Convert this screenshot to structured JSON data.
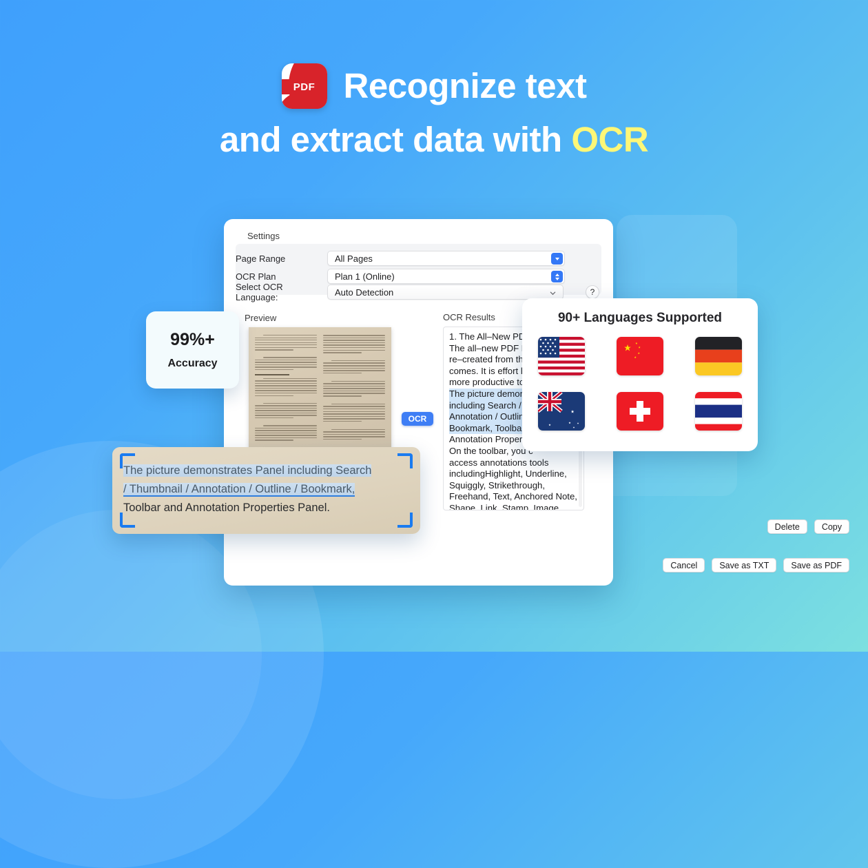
{
  "hero": {
    "icon_name": "pdf-app-icon",
    "icon_label": "PDF",
    "line1": "Recognize text",
    "line2_prefix": "and extract data with ",
    "line2_accent": "OCR",
    "accent_color": "#fdf777",
    "text_color": "#ffffff"
  },
  "background": {
    "gradient_start": "#3fa0fc",
    "gradient_end": "#7ce0e0"
  },
  "dialog": {
    "settings_title": "Settings",
    "rows": [
      {
        "label": "Page Range",
        "value": "All Pages",
        "control": "chevron-down-button"
      },
      {
        "label": "OCR Plan",
        "value": "Plan 1 (Online)",
        "control": "stepper-button"
      },
      {
        "label": "Select OCR Language:",
        "value": "Auto Detection",
        "control": "chevron-down-plain"
      }
    ],
    "help_button": "?",
    "preview_heading": "Preview",
    "results_heading": "OCR Results",
    "ocr_button": "OCR",
    "results_text": {
      "line1": "1. The All–New PDF F",
      "line2": "The all–new PDF Rea",
      "line3": "re–created from the",
      "line4": "comes. It is effort les",
      "line5": "more productive to u",
      "line6": "The picture demonst",
      "line7": "including Search / Th",
      "line8": "Annotation / Outline",
      "line9": "Bookmark,  Toolbar a",
      "line10": "Annotation Propertie",
      "line11": "On the toolbar, you c",
      "line12": "access annotations tools",
      "line13": "includingHighlight, Underline,",
      "line14": "Squiggly, Strikethrough,",
      "line15": "Freehand, Text, Anchored Note,",
      "line16": "Shape, Link, Stamp, Image,"
    },
    "results_actions": [
      {
        "label": "Delete"
      },
      {
        "label": "Copy"
      }
    ],
    "footer_actions": [
      {
        "label": "Cancel"
      },
      {
        "label": "Save as TXT"
      },
      {
        "label": "Save as PDF"
      }
    ]
  },
  "accuracy_card": {
    "value": "99%+",
    "label": "Accuracy"
  },
  "languages_card": {
    "title": "90+ Languages Supported",
    "flags": [
      {
        "name": "flag-usa"
      },
      {
        "name": "flag-china"
      },
      {
        "name": "flag-germany"
      },
      {
        "name": "flag-australia"
      },
      {
        "name": "flag-switzerland"
      },
      {
        "name": "flag-thailand"
      }
    ]
  },
  "callout": {
    "selected_part1": "The picture demonstrates Panel including Search",
    "selected_part2": "/ Thumbnail / Annotation / Outline / Bookmark,",
    "plain_part": "Toolbar and Annotation Properties Panel.",
    "selection_color": "#2f7ede"
  }
}
